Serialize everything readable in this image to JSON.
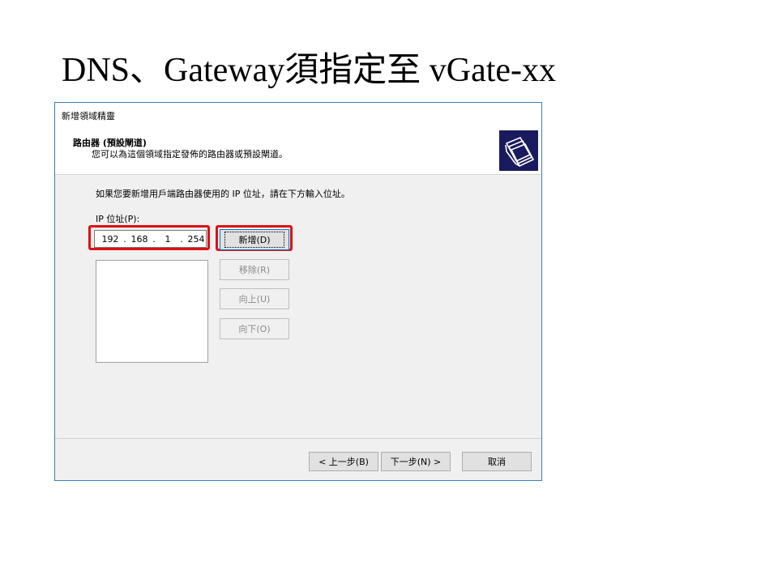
{
  "slide": {
    "title": "DNS、Gateway須指定至 vGate-xx"
  },
  "dialog": {
    "caption": "新增領域精靈",
    "header_title": "路由器 (預設閘道)",
    "header_subtitle": "您可以為這個領域指定發佈的路由器或預設閘道。",
    "instruction": "如果您要新增用戶端路由器使用的 IP 位址，請在下方輸入位址。",
    "ip_label": "IP 位址(P):",
    "ip_octets": [
      "192",
      "168",
      "1",
      "254"
    ],
    "ip_separator": ".",
    "buttons": {
      "add": "新增(D)",
      "remove": "移除(R)",
      "up": "向上(U)",
      "down": "向下(O)",
      "back": "< 上一步(B)",
      "next": "下一步(N) >",
      "cancel": "取消"
    }
  },
  "colors": {
    "highlight": "#e01010",
    "icon_bg": "#1a1a5e",
    "dialog_border": "#3c7fb1"
  }
}
